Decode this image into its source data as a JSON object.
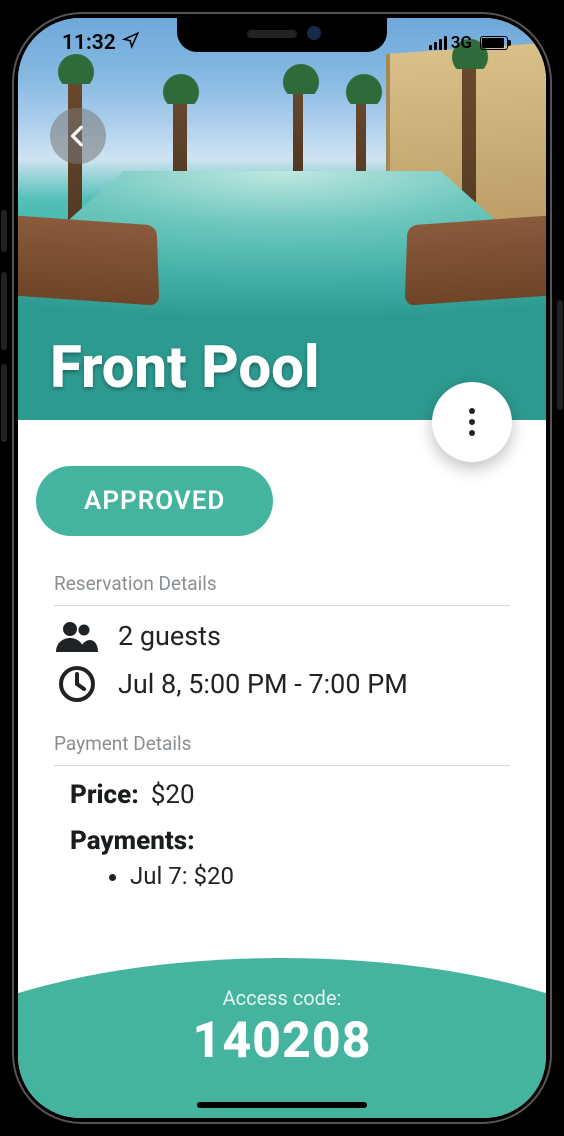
{
  "status_bar": {
    "time": "11:32",
    "location_indicator": "➤",
    "network_label": "3G"
  },
  "header": {
    "title": "Front Pool"
  },
  "status_pill": {
    "label": "APPROVED"
  },
  "sections": {
    "reservation_label": "Reservation Details",
    "payment_label": "Payment Details"
  },
  "reservation": {
    "guests_text": "2 guests",
    "datetime_text": "Jul 8, 5:00 PM - 7:00 PM"
  },
  "payment": {
    "price_label": "Price:",
    "price_value": "$20",
    "payments_label": "Payments:",
    "items": [
      {
        "text": "Jul 7: $20"
      }
    ]
  },
  "access": {
    "label": "Access code:",
    "code": "140208"
  }
}
